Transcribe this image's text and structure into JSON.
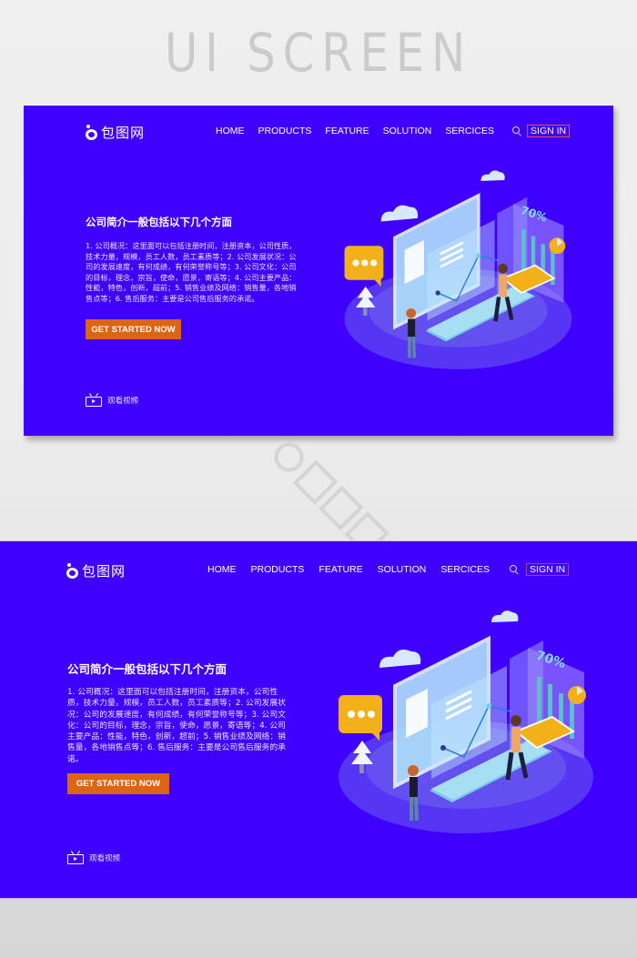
{
  "page": {
    "heading": "UI SCREEN",
    "watermark": "包图网"
  },
  "brand": {
    "logo_text": "包图网",
    "primary_color": "#3f00fd",
    "cta_color": "#dc6514",
    "signin_border_color": "#e4582f"
  },
  "screens": [
    {
      "nav": {
        "items": [
          "HOME",
          "PRODUCTS",
          "FEATURE",
          "SOLUTION",
          "SERCICES"
        ],
        "search_icon": "search-icon",
        "signin_label": "SIGN IN"
      },
      "hero": {
        "title": "公司简介一般包括以下几个方面",
        "description": "1. 公司概况：这里面可以包括注册时间，注册资本，公司性质，技术力量，规模，员工人数，员工素质等；2. 公司发展状况：公司的发展速度，有何成绩，有何荣誉称号等；3. 公司文化：公司的目标，理念，宗旨，使命，愿景，寄语等；4. 公司主要产品：性能，特色，创新，超前；5. 销售业绩及网络：销售量，各地销售点等；6. 售后服务：主要是公司售后服务的承诺。",
        "cta_label": "GET STARTED NOW",
        "video_label": "观看视频",
        "video_icon": "tv-play-icon"
      },
      "illustration": {
        "chart_label": "70%"
      }
    },
    {
      "nav": {
        "items": [
          "HOME",
          "PRODUCTS",
          "FEATURE",
          "SOLUTION",
          "SERCICES"
        ],
        "search_icon": "search-icon",
        "signin_label": "SIGN IN"
      },
      "hero": {
        "title": "公司简介一般包括以下几个方面",
        "description": "1. 公司概况：这里面可以包括注册时间，注册资本，公司性质，技术力量，规模，员工人数，员工素质等；2. 公司发展状况：公司的发展速度，有何成绩，有何荣誉称号等；3. 公司文化：公司的目标，理念，宗旨，使命，愿景，寄语等；4. 公司主要产品：性能，特色，创新，超前；5. 销售业绩及网络：销售量，各地销售点等；6. 售后服务：主要是公司售后服务的承诺。",
        "cta_label": "GET STARTED NOW",
        "video_label": "观看视频",
        "video_icon": "tv-play-icon"
      },
      "illustration": {
        "chart_label": "70%"
      }
    }
  ]
}
